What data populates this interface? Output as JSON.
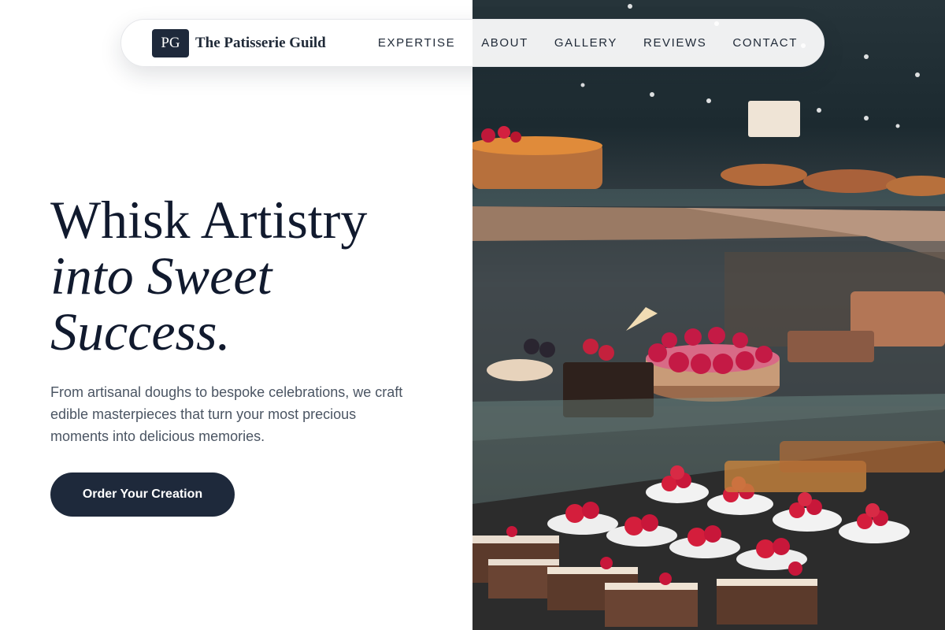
{
  "brand": {
    "mark": "PG",
    "name": "The Patisserie Guild"
  },
  "nav": {
    "items": [
      {
        "label": "EXPERTISE"
      },
      {
        "label": "ABOUT"
      },
      {
        "label": "GALLERY"
      },
      {
        "label": "REVIEWS"
      },
      {
        "label": "CONTACT"
      }
    ]
  },
  "hero": {
    "title_line1": "Whisk Artistry",
    "title_line2": "into Sweet",
    "title_line3": "Success.",
    "body": "From artisanal doughs to bespoke celebrations, we craft edible masterpieces that turn your most precious moments into delicious memories.",
    "cta_label": "Order Your Creation"
  },
  "colors": {
    "navy": "#1e293b",
    "heading": "#111a2e",
    "body_text": "#4b5563",
    "background": "#ffffff"
  },
  "icons": [
    "pastry-display-photo"
  ]
}
